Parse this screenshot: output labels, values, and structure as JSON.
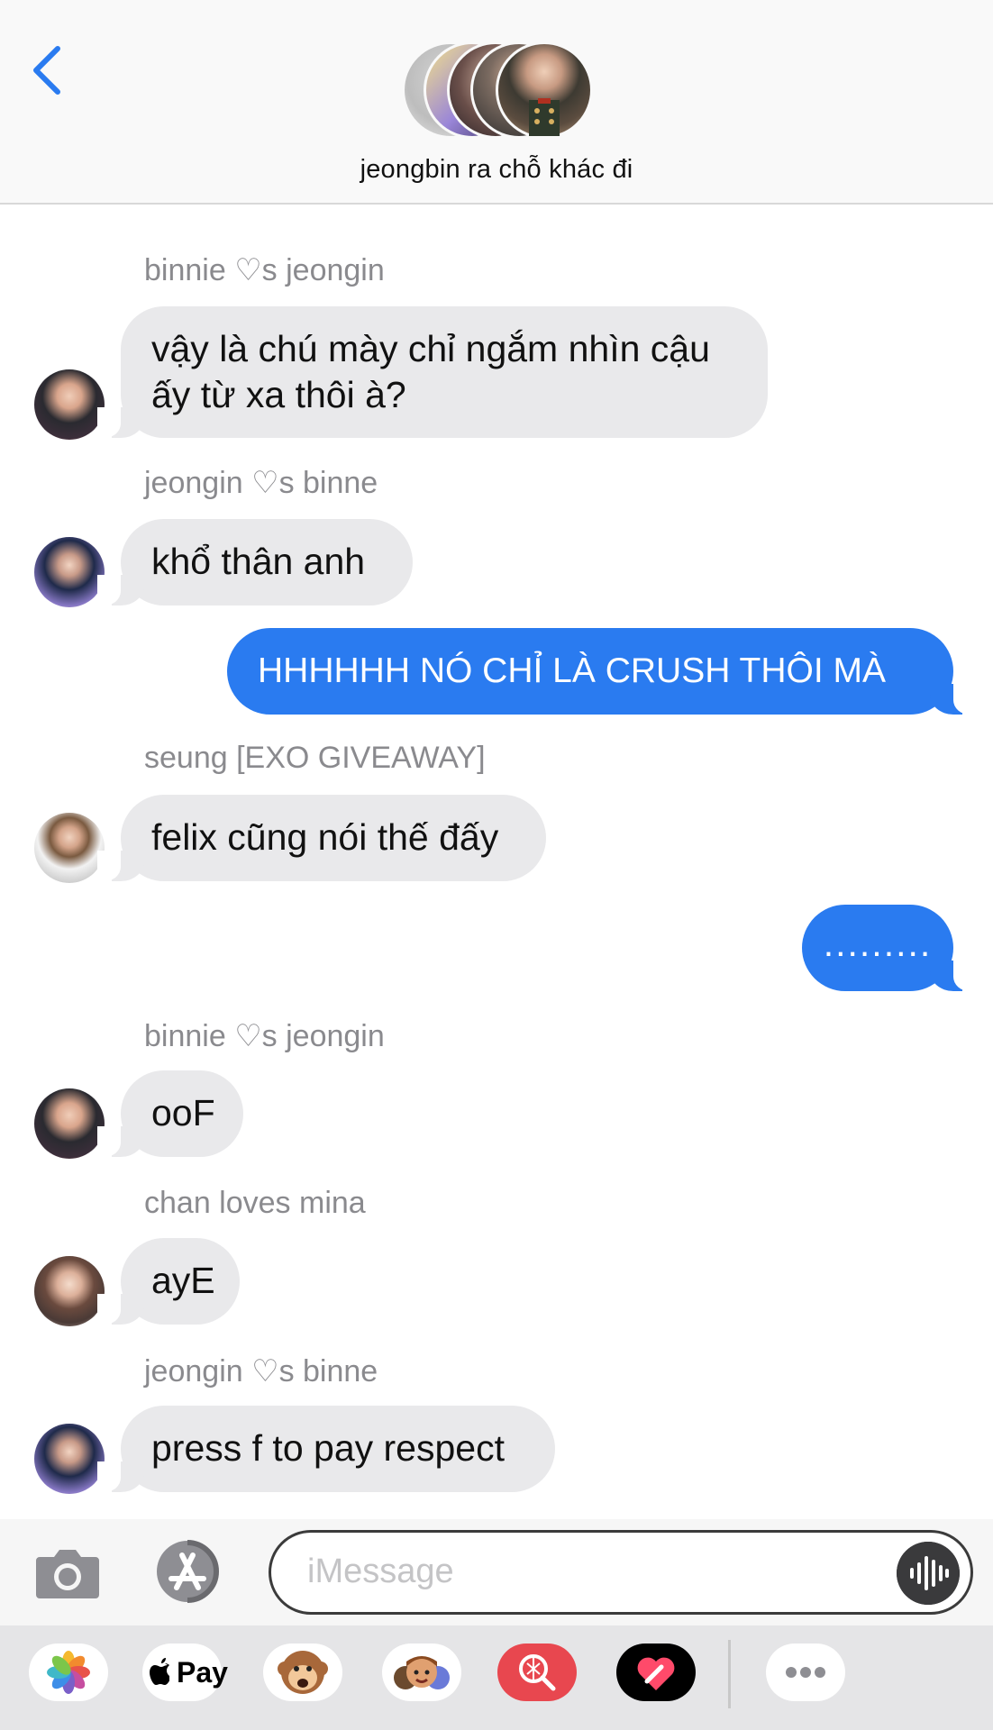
{
  "header": {
    "group_name": "jeongbin ra chỗ khác đi"
  },
  "messages": [
    {
      "sender": "binnie ♡s jeongin",
      "text": "vậy là chú mày chỉ ngắm nhìn cậu\nấy từ xa thôi à?"
    },
    {
      "sender": "jeongin ♡s binne",
      "text": "khổ thân anh"
    },
    {
      "outgoing": true,
      "text": "HHHHHH NÓ CHỈ LÀ CRUSH THÔI MÀ"
    },
    {
      "sender": "seung [EXO GIVEAWAY]",
      "text": "felix cũng nói thế đấy"
    },
    {
      "outgoing": true,
      "text": "........."
    },
    {
      "sender": "binnie ♡s jeongin",
      "text": "ooF"
    },
    {
      "sender": "chan loves mina",
      "text": "ayE"
    },
    {
      "sender": "jeongin ♡s binne",
      "text": "press f to pay respect"
    }
  ],
  "input": {
    "placeholder": "iMessage"
  },
  "drawer": {
    "apple_pay_label": "Pay",
    "icons": [
      "photos-icon",
      "apple-pay-icon",
      "animoji-icon",
      "memoji-icon",
      "image-search-icon",
      "digital-touch-icon",
      "more-icon"
    ]
  },
  "colors": {
    "outgoing": "#2a7bf0",
    "incoming": "#e9e9eb",
    "accent": "#2a7bf0"
  }
}
